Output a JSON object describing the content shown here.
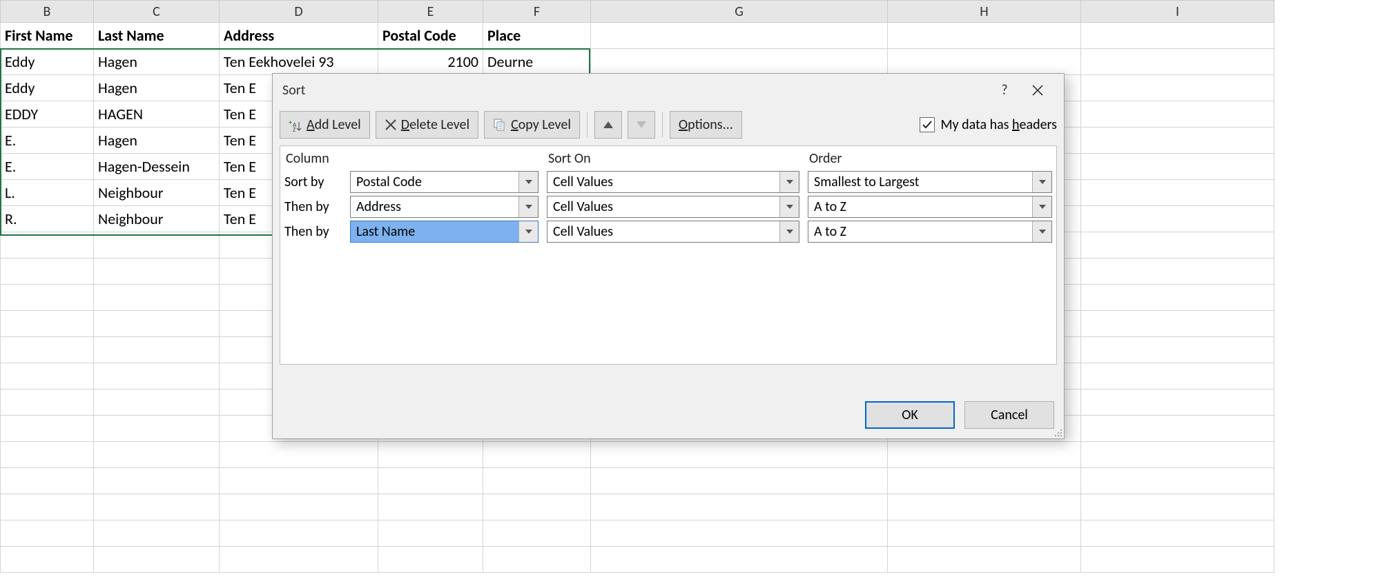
{
  "columns": [
    "B",
    "C",
    "D",
    "E",
    "F",
    "G",
    "H",
    "I"
  ],
  "headers": {
    "B": "First Name",
    "C": "Last Name",
    "D": "Address",
    "E": "Postal Code",
    "F": "Place"
  },
  "rows": [
    {
      "B": "Eddy",
      "C": "Hagen",
      "D": "Ten Eekhovelei 93",
      "E": "2100",
      "F": "Deurne"
    },
    {
      "B": "Eddy",
      "C": "Hagen",
      "D": "Ten E",
      "E": "",
      "F": ""
    },
    {
      "B": "EDDY",
      "C": "HAGEN",
      "D": "Ten E",
      "E": "",
      "F": ""
    },
    {
      "B": "E.",
      "C": "Hagen",
      "D": "Ten E",
      "E": "",
      "F": ""
    },
    {
      "B": "E.",
      "C": "Hagen-Dessein",
      "D": "Ten E",
      "E": "",
      "F": ""
    },
    {
      "B": "L.",
      "C": "Neighbour",
      "D": "Ten E",
      "E": "",
      "F": ""
    },
    {
      "B": "R.",
      "C": "Neighbour",
      "D": "Ten E",
      "E": "",
      "F": ""
    }
  ],
  "dialog": {
    "title": "Sort",
    "toolbar": {
      "add_prefix": "",
      "add_underline": "A",
      "add_rest": "dd Level",
      "delete_prefix": "",
      "delete_underline": "D",
      "delete_rest": "elete Level",
      "copy_prefix": "",
      "copy_underline": "C",
      "copy_rest": "opy Level",
      "options_prefix": "",
      "options_underline": "O",
      "options_rest": "ptions...",
      "headers_prefix": "My data has ",
      "headers_underline": "h",
      "headers_rest": "eaders"
    },
    "columns_header": "Column",
    "sorton_header": "Sort On",
    "order_header": "Order",
    "levels": [
      {
        "label": "Sort by",
        "column": "Postal Code",
        "sorton": "Cell Values",
        "order": "Smallest to Largest",
        "selected": false
      },
      {
        "label": "Then by",
        "column": "Address",
        "sorton": "Cell Values",
        "order": "A to Z",
        "selected": false
      },
      {
        "label": "Then by",
        "column": "Last Name",
        "sorton": "Cell Values",
        "order": "A to Z",
        "selected": true
      }
    ],
    "ok": "OK",
    "cancel": "Cancel",
    "help": "?"
  }
}
